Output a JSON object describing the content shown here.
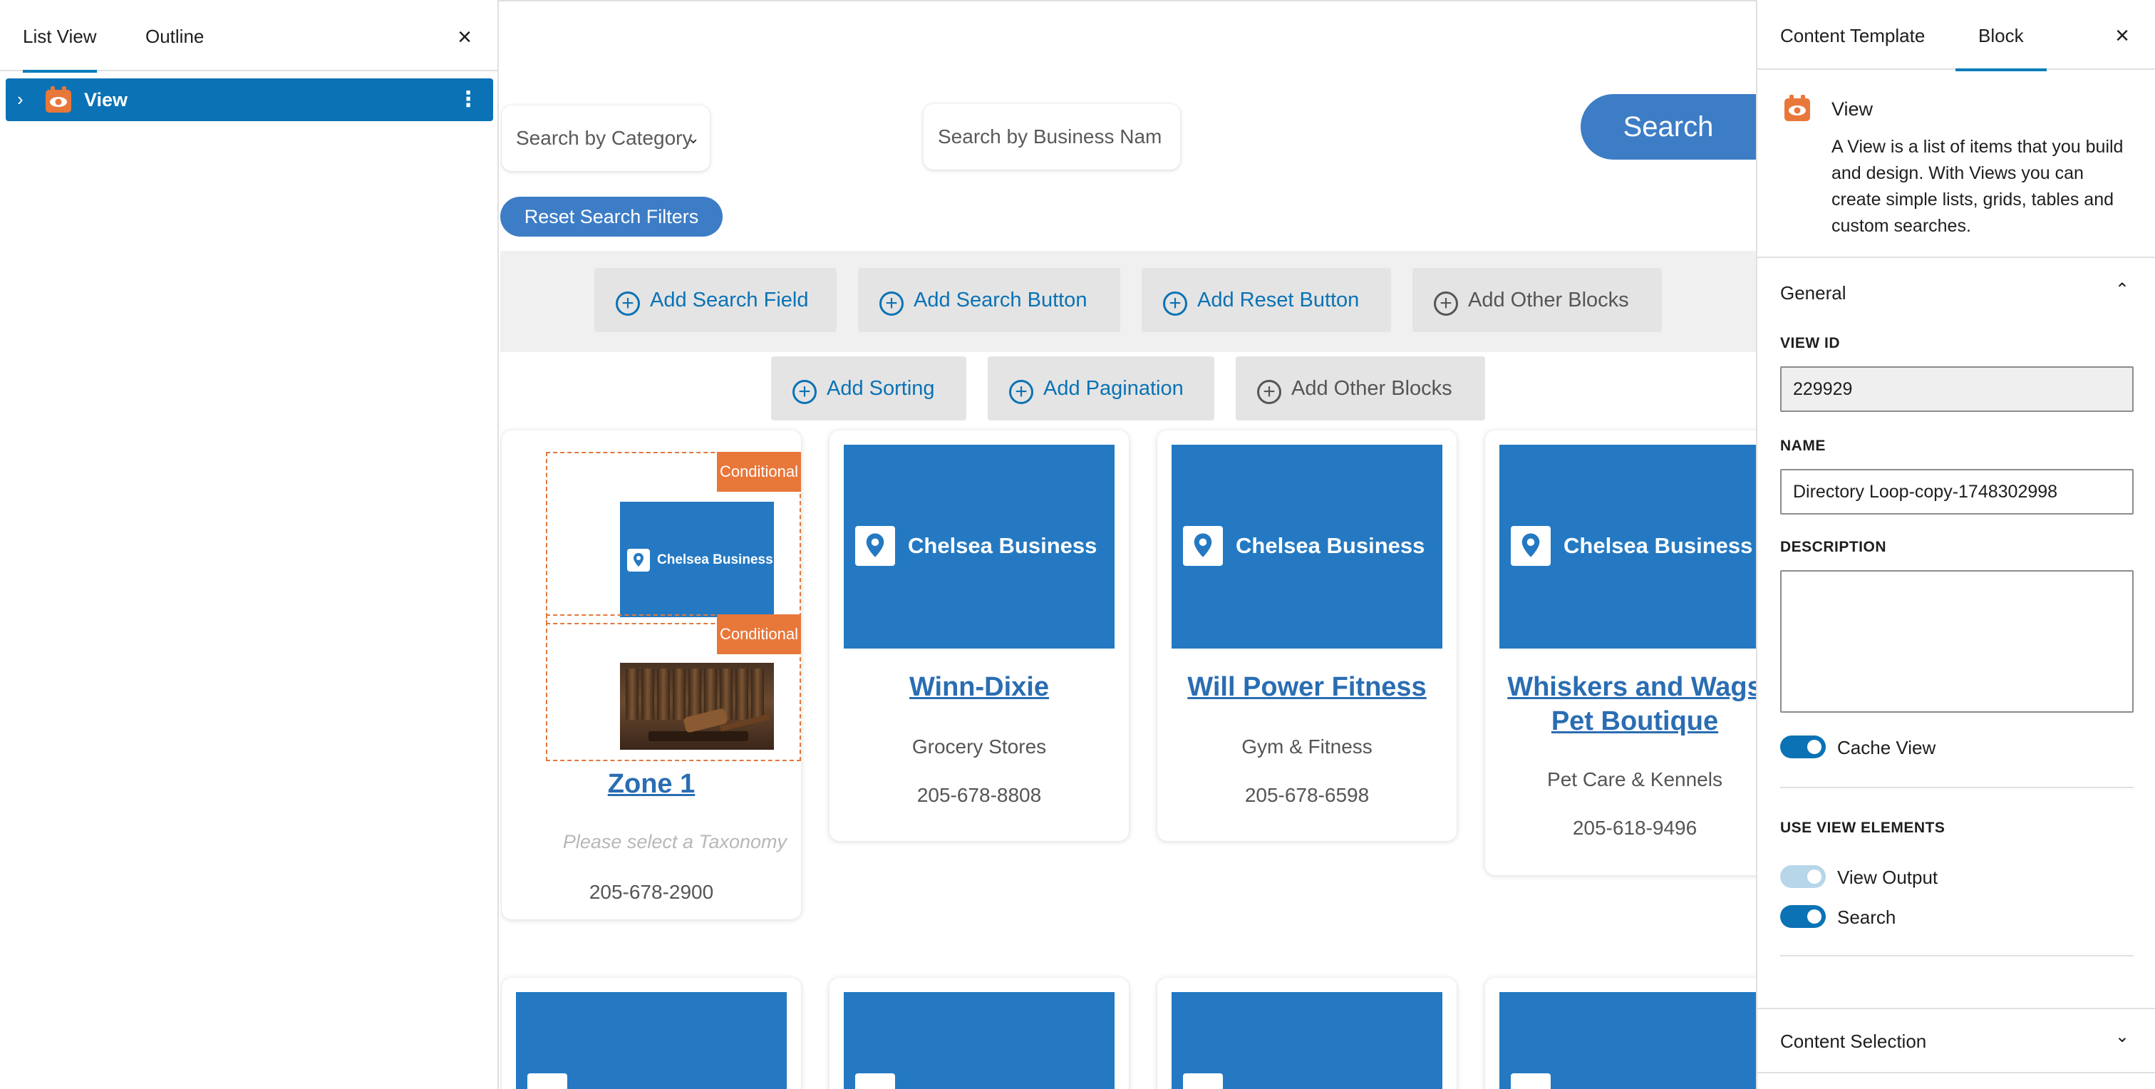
{
  "left_panel": {
    "tabs": [
      "List View",
      "Outline"
    ],
    "close": "×",
    "item": {
      "chevron": "›",
      "label": "View",
      "menu": "⋮"
    }
  },
  "canvas": {
    "category_placeholder": "Search by Category",
    "category_arrow": "⌄",
    "business_placeholder": "Search by Business Nam",
    "search_button": "Search",
    "reset_button": "Reset Search Filters",
    "row1_buttons": [
      "Add Search Field",
      "Add Search Button",
      "Add Reset Button",
      "Add Other Blocks"
    ],
    "row2_buttons": [
      "Add Sorting",
      "Add Pagination",
      "Add Other Blocks"
    ],
    "plus": "+",
    "brand": "Chelsea Business",
    "conditional": "Conditional",
    "cards": [
      {
        "title": "Zone 1",
        "category": "Please select a Taxonomy",
        "phone": "205-678-2900"
      },
      {
        "title": "Winn-Dixie",
        "category": "Grocery Stores",
        "phone": "205-678-8808"
      },
      {
        "title": "Will Power Fitness",
        "category": "Gym & Fitness",
        "phone": "205-678-6598"
      },
      {
        "title": "Whiskers and Wags Pet Boutique",
        "category": "Pet Care & Kennels",
        "phone": "205-618-9496"
      }
    ]
  },
  "right_panel": {
    "tabs": [
      "Content Template",
      "Block"
    ],
    "close": "×",
    "block_name": "View",
    "block_desc": "A View is a list of items that you build and design. With Views you can create simple lists, grids, tables and custom searches.",
    "general": "General",
    "view_id_label": "VIEW ID",
    "view_id": "229929",
    "name_label": "NAME",
    "name": "Directory Loop-copy-1748302998",
    "description_label": "DESCRIPTION",
    "cache_view": "Cache View",
    "use_view_elements": "USE VIEW ELEMENTS",
    "view_output": "View Output",
    "search": "Search",
    "content_selection": "Content Selection",
    "chevron_up": "⌃",
    "chevron_down": "⌄"
  },
  "colors": {
    "accent": "#0a72b5",
    "brand_blue": "#2479c2",
    "search_blue": "#3d7dc6",
    "conditional_orange": "#e8773a"
  }
}
